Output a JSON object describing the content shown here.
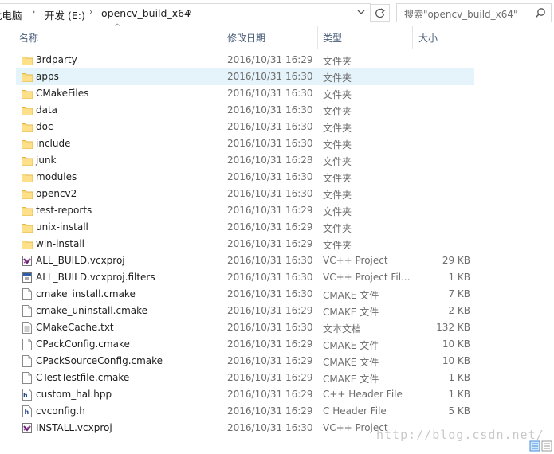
{
  "address": {
    "crumbs": [
      "此电脑",
      "开发 (E:)",
      "opencv_build_x64"
    ]
  },
  "search": {
    "placeholder": "搜索\"opencv_build_x64\""
  },
  "columns": {
    "name": "名称",
    "date": "修改日期",
    "type": "类型",
    "size": "大小"
  },
  "files": [
    {
      "name": "3rdparty",
      "date": "2016/10/31 16:29",
      "type": "文件夹",
      "size": "",
      "icon": "folder-icon"
    },
    {
      "name": "apps",
      "date": "2016/10/31 16:30",
      "type": "文件夹",
      "size": "",
      "icon": "folder-icon",
      "selected": true
    },
    {
      "name": "CMakeFiles",
      "date": "2016/10/31 16:30",
      "type": "文件夹",
      "size": "",
      "icon": "folder-icon"
    },
    {
      "name": "data",
      "date": "2016/10/31 16:30",
      "type": "文件夹",
      "size": "",
      "icon": "folder-icon"
    },
    {
      "name": "doc",
      "date": "2016/10/31 16:30",
      "type": "文件夹",
      "size": "",
      "icon": "folder-icon"
    },
    {
      "name": "include",
      "date": "2016/10/31 16:30",
      "type": "文件夹",
      "size": "",
      "icon": "folder-icon"
    },
    {
      "name": "junk",
      "date": "2016/10/31 16:28",
      "type": "文件夹",
      "size": "",
      "icon": "folder-icon"
    },
    {
      "name": "modules",
      "date": "2016/10/31 16:30",
      "type": "文件夹",
      "size": "",
      "icon": "folder-icon"
    },
    {
      "name": "opencv2",
      "date": "2016/10/31 16:30",
      "type": "文件夹",
      "size": "",
      "icon": "folder-icon"
    },
    {
      "name": "test-reports",
      "date": "2016/10/31 16:29",
      "type": "文件夹",
      "size": "",
      "icon": "folder-icon"
    },
    {
      "name": "unix-install",
      "date": "2016/10/31 16:29",
      "type": "文件夹",
      "size": "",
      "icon": "folder-icon"
    },
    {
      "name": "win-install",
      "date": "2016/10/31 16:29",
      "type": "文件夹",
      "size": "",
      "icon": "folder-icon"
    },
    {
      "name": "ALL_BUILD.vcxproj",
      "date": "2016/10/31 16:30",
      "type": "VC++ Project",
      "size": "29 KB",
      "icon": "vcxproj-icon"
    },
    {
      "name": "ALL_BUILD.vcxproj.filters",
      "date": "2016/10/31 16:30",
      "type": "VC++ Project Fil...",
      "size": "1 KB",
      "icon": "filters-icon"
    },
    {
      "name": "cmake_install.cmake",
      "date": "2016/10/31 16:30",
      "type": "CMAKE 文件",
      "size": "7 KB",
      "icon": "file-icon"
    },
    {
      "name": "cmake_uninstall.cmake",
      "date": "2016/10/31 16:29",
      "type": "CMAKE 文件",
      "size": "2 KB",
      "icon": "file-icon"
    },
    {
      "name": "CMakeCache.txt",
      "date": "2016/10/31 16:30",
      "type": "文本文档",
      "size": "132 KB",
      "icon": "text-file-icon"
    },
    {
      "name": "CPackConfig.cmake",
      "date": "2016/10/31 16:29",
      "type": "CMAKE 文件",
      "size": "10 KB",
      "icon": "file-icon"
    },
    {
      "name": "CPackSourceConfig.cmake",
      "date": "2016/10/31 16:29",
      "type": "CMAKE 文件",
      "size": "10 KB",
      "icon": "file-icon"
    },
    {
      "name": "CTestTestfile.cmake",
      "date": "2016/10/31 16:29",
      "type": "CMAKE 文件",
      "size": "1 KB",
      "icon": "file-icon"
    },
    {
      "name": "custom_hal.hpp",
      "date": "2016/10/31 16:29",
      "type": "C++ Header File",
      "size": "1 KB",
      "icon": "hpp-icon"
    },
    {
      "name": "cvconfig.h",
      "date": "2016/10/31 16:29",
      "type": "C Header File",
      "size": "5 KB",
      "icon": "h-icon"
    },
    {
      "name": "INSTALL.vcxproj",
      "date": "2016/10/31 16:30",
      "type": "VC++ Project",
      "size": "",
      "icon": "vcxproj-icon"
    }
  ],
  "watermark": "http://blog.csdn.net/"
}
